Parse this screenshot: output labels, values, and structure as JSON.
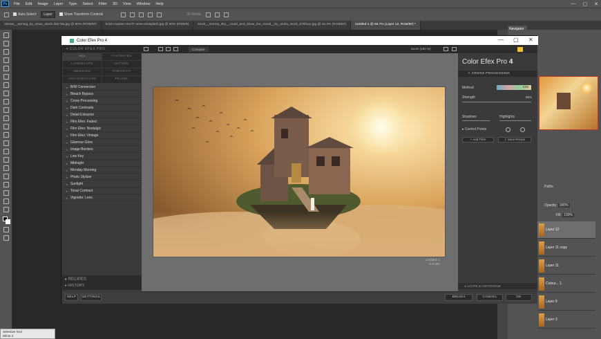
{
  "app": {
    "menu": [
      "File",
      "Edit",
      "Image",
      "Layer",
      "Type",
      "Select",
      "Filter",
      "3D",
      "View",
      "Window",
      "Help"
    ],
    "window_controls": [
      "—",
      "▢",
      "✕"
    ]
  },
  "options_bar": {
    "auto_select_label": "Auto-Select:",
    "layer_value": "Layer",
    "show_transform_label": "Show Transform Controls",
    "mode_3d": "3D Mode:"
  },
  "doc_tabs": [
    {
      "label": "oleosa__turning_by_vinue_stock.dub7da.jpg @ 50% (RGB/8#)",
      "active": false
    },
    {
      "label": "knick-marker-c617F-smw-wmsplash.jpg @ 50% (RGB/8)",
      "active": false
    },
    {
      "label": "stock__stormy_sky__could_and_show_the_result__by_amka_stock_d78f1ox.jpg @ 33.3% (RGB/8#)",
      "active": false
    },
    {
      "label": "Untitled-1 @ 66.7% (Layer 12, RGB/8#) *",
      "active": true
    }
  ],
  "panels": {
    "navigator_tab": "Navigator",
    "paths_label": "Paths",
    "opacity_label": "Opacity:",
    "opacity_value": "100%",
    "fill_label": "Fill:",
    "fill_value": "100%",
    "layers": [
      {
        "name": "Layer 12",
        "selected": true
      },
      {
        "name": "Layer 11 copy",
        "selected": false
      },
      {
        "name": "Layer 11",
        "selected": false
      },
      {
        "name": "Colour... 1",
        "selected": false
      },
      {
        "name": "Layer 9",
        "selected": false
      },
      {
        "name": "Layer 3",
        "selected": false
      }
    ]
  },
  "dialog": {
    "title": "Color Efex Pro 4",
    "left_header": "COLOR EFEX PRO",
    "categories": [
      "ALL",
      "FAVORITES",
      "LANDSCAPE",
      "NATURE",
      "WEDDING",
      "PORTRAIT",
      "ARCHITECTURE",
      "TRAVEL"
    ],
    "filters": [
      "B/W Conversion",
      "Bleach Bypass",
      "Cross Processing",
      "Dark Contrasts",
      "Detail Extractor",
      "Film Efex: Faded",
      "Film Efex: Nostalgic",
      "Film Efex: Vintage",
      "Glamour Glow",
      "Image Borders",
      "Low Key",
      "Midnight",
      "Monday Morning",
      "Photo Stylizer",
      "Sunlight",
      "Tonal Contrast",
      "Vignette: Lens"
    ],
    "recipes": "RECIPES",
    "history": "HISTORY",
    "compare": "Compare",
    "zoom": "Zoom (100 %)",
    "image_info_name": "Untitled-1",
    "image_info_size": "0.9 MP",
    "brand_name": "Color Efex Pro",
    "brand_version": "4",
    "active_filter": "CROSS PROCESSING",
    "method_label": "Method",
    "method_value": "C02",
    "strength_label": "Strength",
    "strength_value": "95%",
    "shadows_label": "Shadows",
    "highlights_label": "Highlights",
    "control_points_label": "Control Points",
    "add_filter": "Add Filter",
    "save_recipe": "Save Recipe",
    "loupe_label": "LOUPE & HISTOGRAM",
    "help": "HELP",
    "settings": "SETTINGS",
    "brush": "BRUSH",
    "cancel": "CANCEL",
    "ok": "OK"
  },
  "status": {
    "line1": "Selective Tool",
    "line2": "Dilme 2"
  }
}
